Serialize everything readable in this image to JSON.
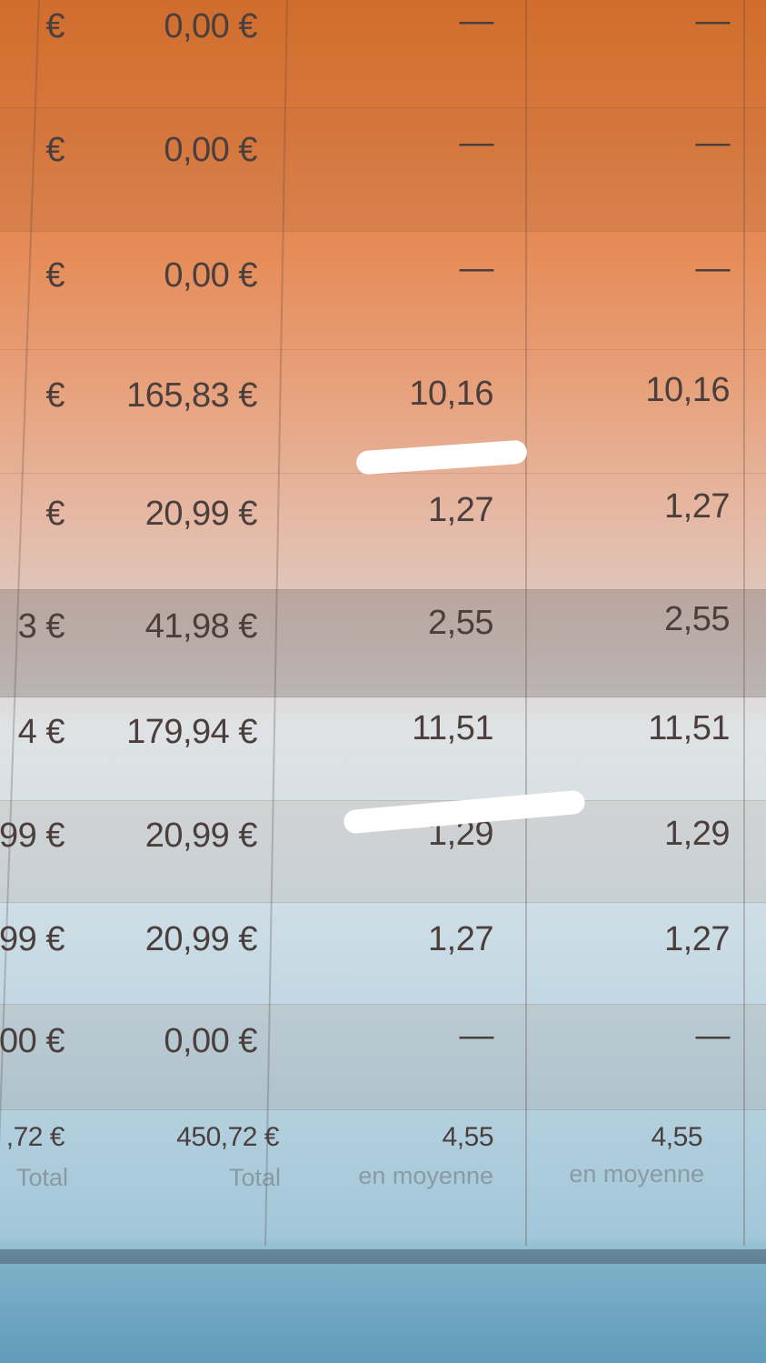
{
  "table": {
    "rows": [
      {
        "c0": "€",
        "c1": "0,00 €",
        "c2": "—",
        "c3": "—"
      },
      {
        "c0": "€",
        "c1": "0,00 €",
        "c2": "—",
        "c3": "—"
      },
      {
        "c0": "€",
        "c1": "0,00 €",
        "c2": "—",
        "c3": "—"
      },
      {
        "c0": "€",
        "c1": "165,83 €",
        "c2": "10,16",
        "c3": "10,16"
      },
      {
        "c0": "€",
        "c1": "20,99 €",
        "c2": "1,27",
        "c3": "1,27"
      },
      {
        "c0": "3 €",
        "c1": "41,98 €",
        "c2": "2,55",
        "c3": "2,55"
      },
      {
        "c0": "4 €",
        "c1": "179,94 €",
        "c2": "11,51",
        "c3": "11,51"
      },
      {
        "c0": "99 €",
        "c1": "20,99 €",
        "c2": "1,29",
        "c3": "1,29"
      },
      {
        "c0": "99 €",
        "c1": "20,99 €",
        "c2": "1,27",
        "c3": "1,27"
      },
      {
        "c0": "00 €",
        "c1": "0,00 €",
        "c2": "—",
        "c3": "—"
      }
    ],
    "totals": {
      "c0": ",72 €",
      "c0_sub": "Total",
      "c1": "450,72 €",
      "c1_sub": "Total",
      "c2": "4,55",
      "c2_sub": "en moyenne",
      "c3": "4,55",
      "c3_sub": "en moyenne"
    }
  }
}
